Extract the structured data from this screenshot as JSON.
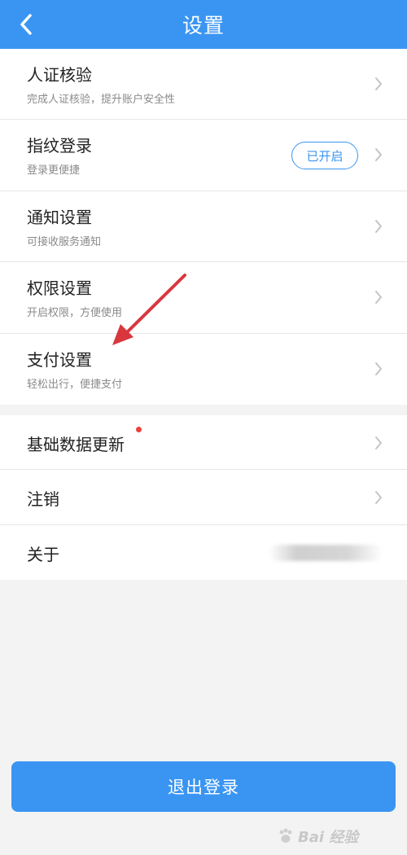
{
  "header": {
    "title": "设置"
  },
  "group1": [
    {
      "title": "人证核验",
      "subtitle": "完成人证核验，提升账户安全性"
    },
    {
      "title": "指纹登录",
      "subtitle": "登录更便捷",
      "badge": "已开启"
    },
    {
      "title": "通知设置",
      "subtitle": "可接收服务通知"
    },
    {
      "title": "权限设置",
      "subtitle": "开启权限，方便使用"
    },
    {
      "title": "支付设置",
      "subtitle": "轻松出行，便捷支付"
    }
  ],
  "group2": [
    {
      "title": "基础数据更新"
    },
    {
      "title": "注销"
    },
    {
      "title": "关于"
    }
  ],
  "logout": {
    "label": "退出登录"
  },
  "watermark": {
    "text": "Bai 经验"
  },
  "colors": {
    "accent": "#3a95f2",
    "annotation_arrow": "#d9363e",
    "red_dot": "#e8443a"
  }
}
